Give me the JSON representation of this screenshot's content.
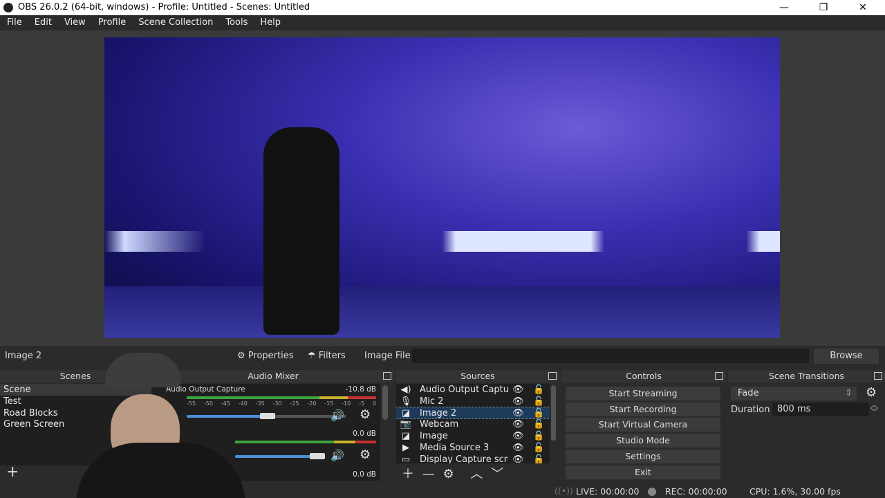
{
  "window": {
    "title": "OBS 26.0.2 (64-bit, windows) - Profile: Untitled - Scenes: Untitled",
    "minimize": "—",
    "maximize": "❐",
    "close": "✕"
  },
  "menu": [
    "File",
    "Edit",
    "View",
    "Profile",
    "Scene Collection",
    "Tools",
    "Help"
  ],
  "toolbar": {
    "selected_source": "Image 2",
    "properties": "Properties",
    "filters": "Filters",
    "image_file_label": "Image File",
    "image_file_value": "",
    "browse": "Browse"
  },
  "scenes": {
    "title": "Scenes",
    "items": [
      "Scene",
      "Test",
      "Road Blocks",
      "Green Screen"
    ],
    "selected": "Scene",
    "add": "+"
  },
  "mixer": {
    "title": "Audio Mixer",
    "channels": [
      {
        "name": "Audio Output Capture",
        "level": "-10.8 dB",
        "volume": 0.6
      },
      {
        "name": "",
        "level": "0.0 dB",
        "volume": 1.0
      },
      {
        "name": "",
        "level": "0.0 dB",
        "volume": 1.0
      }
    ],
    "scale": [
      "-55",
      "-50",
      "-45",
      "-40",
      "-35",
      "-30",
      "-25",
      "-20",
      "-15",
      "-10",
      "-5",
      "0"
    ]
  },
  "sources": {
    "title": "Sources",
    "items": [
      {
        "name": "Audio Output Capture",
        "icon": "speaker-icon"
      },
      {
        "name": "Mic 2",
        "icon": "microphone-icon"
      },
      {
        "name": "Image 2",
        "icon": "image-icon",
        "selected": true
      },
      {
        "name": "Webcam",
        "icon": "camera-icon"
      },
      {
        "name": "Image",
        "icon": "image-icon"
      },
      {
        "name": "Media Source 3",
        "icon": "play-icon"
      },
      {
        "name": "Display Capture screen",
        "icon": "monitor-icon"
      }
    ]
  },
  "controls": {
    "title": "Controls",
    "buttons": [
      "Start Streaming",
      "Start Recording",
      "Start Virtual Camera",
      "Studio Mode",
      "Settings",
      "Exit"
    ]
  },
  "transitions": {
    "title": "Scene Transitions",
    "type": "Fade",
    "duration_label": "Duration",
    "duration": "800 ms"
  },
  "status": {
    "live": "LIVE: 00:00:00",
    "rec": "REC: 00:00:00",
    "cpu": "CPU: 1.6%, 30.00 fps"
  },
  "colors": {
    "accent_selected": "#1d3a5a",
    "meter_green": "#3da53d",
    "meter_yellow": "#c9b32b",
    "meter_red": "#c83232",
    "slider": "#4a90d9"
  }
}
